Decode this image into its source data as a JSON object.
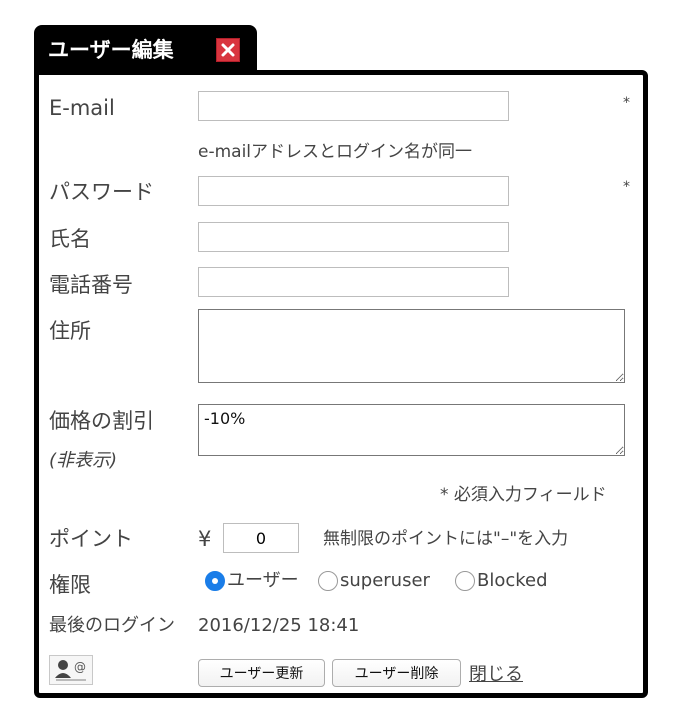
{
  "dialog": {
    "title": "ユーザー編集",
    "required_marker": "*",
    "required_note": "* 必須入力フィールド"
  },
  "form": {
    "email_label": "E-mail",
    "email_value": "",
    "email_note": "e-mailアドレスとログイン名が同一",
    "password_label": "パスワード",
    "password_value": "",
    "name_label": "氏名",
    "name_value": "",
    "phone_label": "電話番号",
    "phone_value": "",
    "address_label": "住所",
    "address_value": "",
    "discount_label": "価格の割引",
    "discount_sublabel": "(非表示)",
    "discount_value": "-10%",
    "points_label": "ポイント",
    "points_currency": "¥",
    "points_value": "0",
    "points_note": "無制限のポイントには\"–\"を入力",
    "permission_label": "権限",
    "permission_options": [
      "ユーザー",
      "superuser",
      "Blocked"
    ],
    "permission_selected": "ユーザー",
    "last_login_label": "最後のログイン",
    "last_login_value": "2016/12/25 18:41"
  },
  "actions": {
    "update_label": "ユーザー更新",
    "delete_label": "ユーザー削除",
    "close_label": "閉じる"
  },
  "colors": {
    "border": "#000000",
    "close_icon": "#d9353f",
    "radio_selected": "#1a7de8"
  },
  "icons": {
    "close": "close-icon",
    "user_email": "user-email-icon"
  }
}
